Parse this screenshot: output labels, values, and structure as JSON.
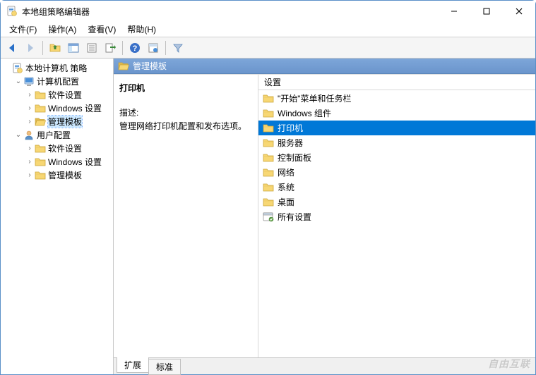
{
  "window": {
    "title": "本地组策略编辑器"
  },
  "menu": {
    "file": "文件(F)",
    "action": "操作(A)",
    "view": "查看(V)",
    "help": "帮助(H)"
  },
  "tree": {
    "root": "本地计算机 策略",
    "computer": "计算机配置",
    "computer_children": {
      "software": "软件设置",
      "windows": "Windows 设置",
      "templates": "管理模板"
    },
    "user": "用户配置",
    "user_children": {
      "software": "软件设置",
      "windows": "Windows 设置",
      "templates": "管理模板"
    }
  },
  "content": {
    "header": "管理模板",
    "selected_title": "打印机",
    "desc_label": "描述:",
    "desc_text": "管理网络打印机配置和发布选项。",
    "settings_col": "设置",
    "items": {
      "start_menu": "\"开始\"菜单和任务栏",
      "win_components": "Windows 组件",
      "printers": "打印机",
      "servers": "服务器",
      "control_panel": "控制面板",
      "network": "网络",
      "system": "系统",
      "desktop": "桌面",
      "all_settings": "所有设置"
    }
  },
  "tabs": {
    "extended": "扩展",
    "standard": "标准"
  },
  "watermark": "自由互联"
}
